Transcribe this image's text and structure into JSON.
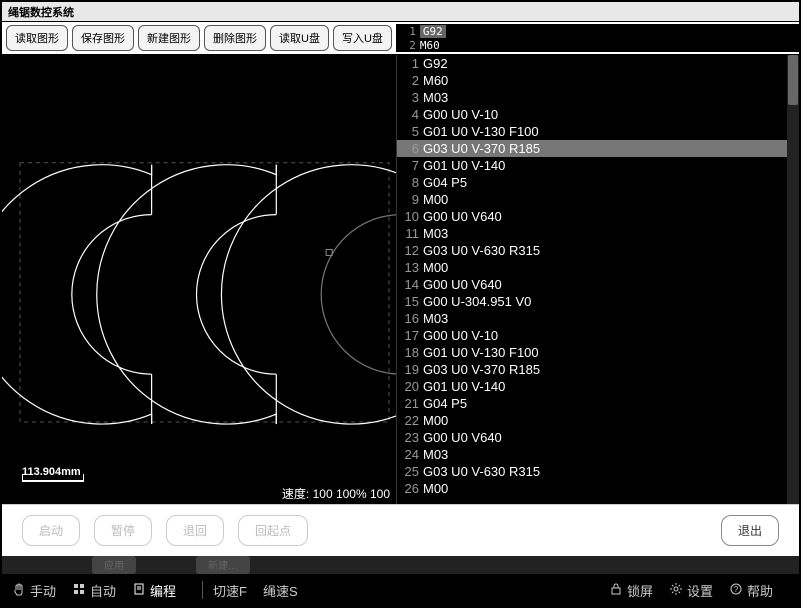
{
  "window": {
    "title": "绳锯数控系统"
  },
  "toolbar": {
    "buttons": [
      "读取图形",
      "保存图形",
      "新建图形",
      "删除图形",
      "读取U盘",
      "写入U盘"
    ],
    "top_preview": [
      {
        "n": "1",
        "t": "G92",
        "hl": true
      },
      {
        "n": "2",
        "t": "M60",
        "hl": false
      }
    ]
  },
  "canvas": {
    "scale_label": "113.904mm",
    "speed_label": "速度: 100 100% 100"
  },
  "code": {
    "selected": 6,
    "lines": [
      {
        "n": 1,
        "t": "G92"
      },
      {
        "n": 2,
        "t": "M60"
      },
      {
        "n": 3,
        "t": "M03"
      },
      {
        "n": 4,
        "t": "G00 U0 V-10"
      },
      {
        "n": 5,
        "t": "G01 U0 V-130 F100"
      },
      {
        "n": 6,
        "t": "G03 U0 V-370 R185"
      },
      {
        "n": 7,
        "t": "G01 U0 V-140"
      },
      {
        "n": 8,
        "t": "G04 P5"
      },
      {
        "n": 9,
        "t": "M00"
      },
      {
        "n": 10,
        "t": "G00 U0 V640"
      },
      {
        "n": 11,
        "t": "M03"
      },
      {
        "n": 12,
        "t": "G03 U0 V-630 R315"
      },
      {
        "n": 13,
        "t": "M00"
      },
      {
        "n": 14,
        "t": "G00 U0 V640"
      },
      {
        "n": 15,
        "t": "G00 U-304.951 V0"
      },
      {
        "n": 16,
        "t": "M03"
      },
      {
        "n": 17,
        "t": "G00 U0 V-10"
      },
      {
        "n": 18,
        "t": "G01 U0 V-130 F100"
      },
      {
        "n": 19,
        "t": "G03 U0 V-370 R185"
      },
      {
        "n": 20,
        "t": "G01 U0 V-140"
      },
      {
        "n": 21,
        "t": "G04 P5"
      },
      {
        "n": 22,
        "t": "M00"
      },
      {
        "n": 23,
        "t": "G00 U0 V640"
      },
      {
        "n": 24,
        "t": "M03"
      },
      {
        "n": 25,
        "t": "G03 U0 V-630 R315"
      },
      {
        "n": 26,
        "t": "M00"
      }
    ]
  },
  "controls": {
    "buttons": [
      {
        "label": "启动",
        "active": false
      },
      {
        "label": "暂停",
        "active": false
      },
      {
        "label": "退回",
        "active": false
      },
      {
        "label": "回起点",
        "active": false
      }
    ],
    "exit": "退出"
  },
  "hidden_strip": [
    "应用",
    "新建…"
  ],
  "bottombar": {
    "left": [
      {
        "icon": "hand",
        "label": "手动"
      },
      {
        "icon": "grid",
        "label": "自动"
      },
      {
        "icon": "doc",
        "label": "编程",
        "selected": true
      }
    ],
    "mid": [
      {
        "label": "切速F"
      },
      {
        "label": "绳速S"
      }
    ],
    "right": [
      {
        "icon": "lock",
        "label": "锁屏"
      },
      {
        "icon": "gear",
        "label": "设置"
      },
      {
        "icon": "help",
        "label": "帮助"
      }
    ]
  }
}
